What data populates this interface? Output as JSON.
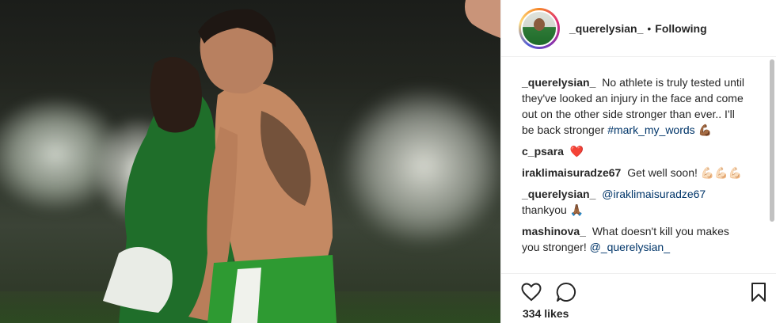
{
  "post": {
    "author": "_querelysian_",
    "follow_status": "Following",
    "separator": "•",
    "likes": "334 likes"
  },
  "comments": [
    {
      "user": "_querelysian_",
      "text": "No athlete is truly tested until they've looked an injury in the face and come out on the other side stronger than ever.. I'll be back stronger",
      "hashtag": "#mark_my_words",
      "emoji": "💪🏾"
    },
    {
      "user": "c_psara",
      "text": "",
      "emoji": "❤️"
    },
    {
      "user": "iraklimaisuradze67",
      "text": "Get well soon!",
      "emoji": "💪🏻💪🏻💪🏻"
    },
    {
      "user": "_querelysian_",
      "mention": "@iraklimaisuradze67",
      "text": "thankyou",
      "emoji": "🙏🏾"
    },
    {
      "user": "mashinova_",
      "text": "What doesn't kill you makes you stronger!",
      "mention": "@_querelysian_"
    }
  ],
  "icons": {
    "like": "heart-outline-icon",
    "comment": "comment-bubble-icon",
    "save": "bookmark-icon"
  },
  "colors": {
    "link": "#003569",
    "text": "#262626",
    "heart_red": "#ed4956"
  }
}
